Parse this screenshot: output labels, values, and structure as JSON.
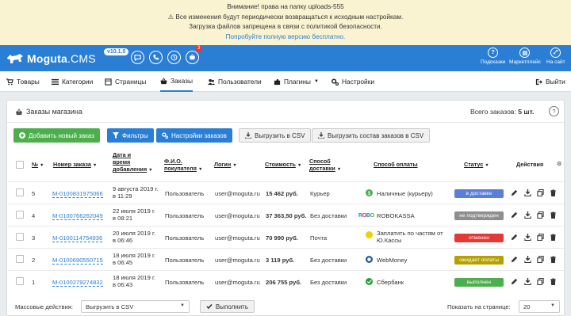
{
  "notice": {
    "line1": "Внимание! права на папку uploads-555",
    "line2": "Все изменения будут периодически возвращаться к исходным настройкам.",
    "line3": "Загрузка файлов запрещена в связи с политикой безопасности.",
    "link": "Попробуйте полную версию бесплатно."
  },
  "topbar": {
    "brand": "Moguta",
    "brand_suffix": ".CMS",
    "version": "v10.1.0",
    "cart_count": "3",
    "help_label": "Подсказки",
    "market_label": "Маркетплейс",
    "site_label": "На сайт"
  },
  "nav": {
    "items": [
      {
        "label": "Товары",
        "icon": "cart-icon"
      },
      {
        "label": "Категории",
        "icon": "list-icon"
      },
      {
        "label": "Страницы",
        "icon": "pages-icon"
      },
      {
        "label": "Заказы",
        "icon": "basket-icon"
      },
      {
        "label": "Пользователи",
        "icon": "users-icon"
      },
      {
        "label": "Плагины",
        "icon": "puzzle-icon"
      },
      {
        "label": "Настройки",
        "icon": "gears-icon"
      }
    ],
    "logout": "Выйти"
  },
  "panel": {
    "title": "Заказы магазина",
    "total_label": "Всего заказов:",
    "total_value": "5 шт.",
    "help": "?"
  },
  "buttons": {
    "add": "Добавить новый заказ",
    "filters": "Фильтры",
    "settings": "Настройки заказов",
    "export_csv": "Выгрузить в CSV",
    "export_items": "Выгрузить состав заказов в CSV"
  },
  "table": {
    "headers": {
      "num": "№",
      "order": "Номер заказа",
      "date_l1": "Дата и",
      "date_l2": "время",
      "date_l3": "добавления",
      "fio_l1": "Ф.И.О.",
      "fio_l2": "покупателя",
      "login": "Логин",
      "cost": "Стоимость",
      "delivery_l1": "Способ",
      "delivery_l2": "доставки",
      "payment": "Способ оплаты",
      "status": "Статус",
      "actions": "Действия"
    },
    "rows": [
      {
        "num": "5",
        "order": "M-0100831975066",
        "date1": "9 августа 2019 г.",
        "date2": "в 11:29",
        "fio": "Пользователь",
        "login": "user@moguta.ru",
        "cost": "15 462 руб.",
        "delivery": "Курьер",
        "pay1": "Наличные (курьеру)",
        "pay2": "",
        "pay_icon": "cash-icon",
        "status": "в доставке",
        "status_color": "#5b7fd6"
      },
      {
        "num": "4",
        "order": "M-0100766262049",
        "date1": "22 июля 2019 г.",
        "date2": "в 08:21",
        "fio": "Пользователь",
        "login": "user@moguta.ru",
        "cost": "37 363,50 руб.",
        "delivery": "Без доставки",
        "pay1": "ROBOKASSA",
        "pay2": "",
        "pay_icon": "robokassa-icon",
        "status": "не подтвержден",
        "status_color": "#8e8e8e"
      },
      {
        "num": "3",
        "order": "M-0100114754936",
        "date1": "20 июля 2019 г.",
        "date2": "в 06:46",
        "fio": "Пользователь",
        "login": "user@moguta.ru",
        "cost": "70 990 руб.",
        "delivery": "Почта",
        "pay1": "Заплатить по частям от",
        "pay2": "Ю.Кассы",
        "pay_icon": "yookassa-icon",
        "status": "отменен",
        "status_color": "#e53935"
      },
      {
        "num": "2",
        "order": "M-0100690550715",
        "date1": "18 июля 2019 г.",
        "date2": "в 06:45",
        "fio": "Пользователь",
        "login": "user@moguta.ru",
        "cost": "3 119 руб.",
        "delivery": "Без доставки",
        "pay1": "WebMoney",
        "pay2": "",
        "pay_icon": "webmoney-icon",
        "status": "ожидает оплаты",
        "status_color": "#b5a000"
      },
      {
        "num": "1",
        "order": "M-0100279274832",
        "date1": "18 июля 2019 г.",
        "date2": "в 06:43",
        "fio": "Пользователь",
        "login": "user@moguta.ru",
        "cost": "206 755 руб.",
        "delivery": "Без доставки",
        "pay1": "Сбербанк",
        "pay2": "",
        "pay_icon": "sberbank-icon",
        "status": "выполнен",
        "status_color": "#4cae4c"
      }
    ]
  },
  "footer": {
    "mass_label": "Массовые действия:",
    "mass_value": "Выгрузить в CSV",
    "execute": "Выполнить",
    "per_page_label": "Показать на странице:",
    "per_page_value": "20"
  }
}
